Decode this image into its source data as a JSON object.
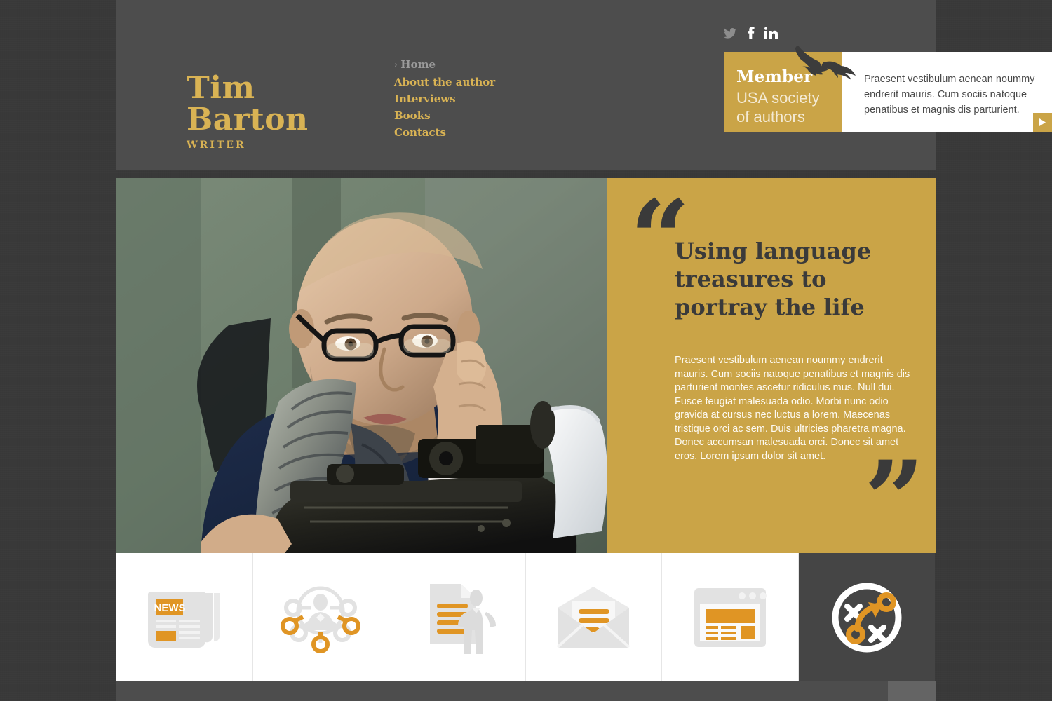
{
  "colors": {
    "page_background": "#393939",
    "header_background": "#4d4d4d",
    "gold": "#caa447",
    "gold_text": "#d9b354",
    "dark_text": "#3a3a3a",
    "icon_orange": "#e09524",
    "icon_gray": "#e2e2e2",
    "tile_dark": "#454545"
  },
  "header": {
    "logo": {
      "name": "Tim Barton",
      "name_line1": "Tim",
      "name_line2": "Barton",
      "tagline": "WRITER"
    },
    "nav": [
      {
        "label": "Home",
        "active": true,
        "caret": "›"
      },
      {
        "label": "About the author",
        "active": false
      },
      {
        "label": "Interviews",
        "active": false
      },
      {
        "label": "Books",
        "active": false
      },
      {
        "label": "Contacts",
        "active": false
      }
    ],
    "social": [
      {
        "name": "twitter-icon",
        "label": "Twitter"
      },
      {
        "name": "facebook-icon",
        "label": "f"
      },
      {
        "name": "linkedin-icon",
        "label": "in"
      }
    ],
    "member_banner": {
      "title": "Member",
      "subtitle": "USA society of authors",
      "subtitle_line1": "USA society",
      "subtitle_line2": "of authors",
      "text": "Praesent vestibulum aenean noummy endrerit mauris. Cum sociis natoque penatibus et magnis dis parturient.",
      "next_label": "▶",
      "eagle_icon": "eagle-icon"
    }
  },
  "hero": {
    "photo_alt": "Bald man with glasses and scarf at a vintage typewriter",
    "quote": {
      "open_mark": "“",
      "close_mark": "”",
      "title": "Using language treasures to portray the life",
      "body": "Praesent vestibulum aenean noummy endrerit mauris. Cum sociis natoque penatibus et magnis dis parturient montes ascetur ridiculus mus. Null dui. Fusce feugiat malesuada odio. Morbi nunc odio gravida at cursus nec luctus a lorem. Maecenas tristique orci ac sem. Duis ultricies pharetra magna. Donec accumsan malesuada orci. Donec sit amet eros. Lorem ipsum dolor sit amet."
    }
  },
  "icon_strip": {
    "tiles": [
      {
        "icon": "newspaper-icon",
        "label": "News",
        "badge_text": "NEWS",
        "dark": false
      },
      {
        "icon": "network-person-icon",
        "label": "Network",
        "dark": false
      },
      {
        "icon": "document-person-icon",
        "label": "Article",
        "dark": false
      },
      {
        "icon": "envelope-letter-icon",
        "label": "Mail",
        "dark": false
      },
      {
        "icon": "browser-window-icon",
        "label": "Website",
        "dark": false
      },
      {
        "icon": "strategy-icon",
        "label": "Strategy",
        "dark": true
      }
    ]
  },
  "footer": {
    "scrollbar": "horizontal-scroll-thumb"
  }
}
